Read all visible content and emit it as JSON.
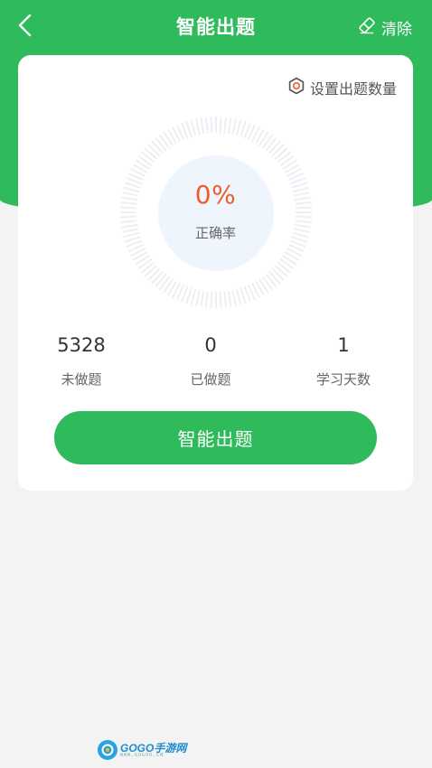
{
  "header": {
    "title": "智能出题",
    "clear_label": "清除"
  },
  "card": {
    "settings_label": "设置出题数量",
    "accuracy": {
      "value": "0%",
      "label": "正确率",
      "fraction": 0
    },
    "stats": [
      {
        "value": "5328",
        "label": "未做题"
      },
      {
        "value": "0",
        "label": "已做题"
      },
      {
        "value": "1",
        "label": "学习天数"
      }
    ],
    "start_button_label": "智能出题"
  },
  "watermark": {
    "main": "GOGO手游网",
    "sub": "WWW.GOGOO.CN"
  },
  "colors": {
    "brand_green": "#2fba5b",
    "accuracy_orange": "#ee5c2a",
    "gauge_fill": "#eff5fd",
    "background": "#f3f3f3"
  },
  "icons": {
    "back": "chevron-left-icon",
    "clear": "eraser-icon",
    "settings": "gear-icon"
  }
}
